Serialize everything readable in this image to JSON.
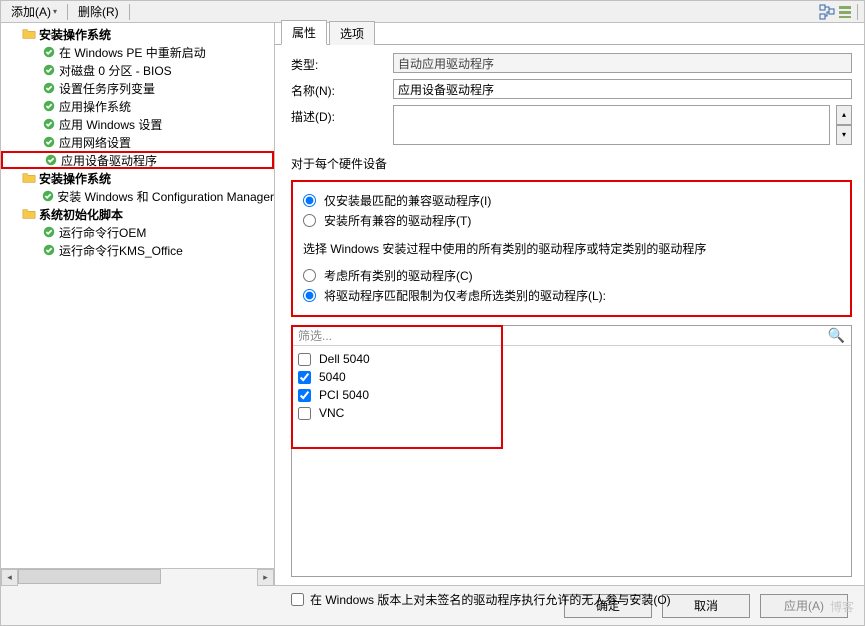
{
  "toolbar": {
    "add_label": "添加(A)",
    "delete_label": "删除(R)"
  },
  "tree": {
    "nodes": [
      {
        "level": 0,
        "icon": "folder",
        "label": "安装操作系统",
        "bold": true
      },
      {
        "level": 1,
        "icon": "check",
        "label": "在 Windows PE 中重新启动"
      },
      {
        "level": 1,
        "icon": "check",
        "label": "对磁盘 0 分区 - BIOS"
      },
      {
        "level": 1,
        "icon": "check",
        "label": "设置任务序列变量"
      },
      {
        "level": 1,
        "icon": "check",
        "label": "应用操作系统"
      },
      {
        "level": 1,
        "icon": "check",
        "label": "应用 Windows 设置"
      },
      {
        "level": 1,
        "icon": "check",
        "label": "应用网络设置"
      },
      {
        "level": 1,
        "icon": "check",
        "label": "应用设备驱动程序",
        "highlight": true
      },
      {
        "level": 0,
        "icon": "folder",
        "label": "安装操作系统",
        "bold": true
      },
      {
        "level": 1,
        "icon": "check",
        "label": "安装 Windows 和 Configuration Manager"
      },
      {
        "level": 0,
        "icon": "folder",
        "label": "系统初始化脚本",
        "bold": true
      },
      {
        "level": 1,
        "icon": "check",
        "label": "运行命令行OEM"
      },
      {
        "level": 1,
        "icon": "check",
        "label": "运行命令行KMS_Office"
      }
    ]
  },
  "tabs": {
    "properties": "属性",
    "options": "选项"
  },
  "form": {
    "type_label": "类型:",
    "type_value": "自动应用驱动程序",
    "name_label": "名称(N):",
    "name_value": "应用设备驱动程序",
    "desc_label": "描述(D):",
    "desc_value": ""
  },
  "hw_section": {
    "title": "对于每个硬件设备",
    "radio_best": "仅安装最匹配的兼容驱动程序(I)",
    "radio_all": "安装所有兼容的驱动程序(T)",
    "explain": "选择 Windows 安装过程中使用的所有类别的驱动程序或特定类别的驱动程序",
    "radio_allcat": "考虑所有类别的驱动程序(C)",
    "radio_limit": "将驱动程序匹配限制为仅考虑所选类别的驱动程序(L):"
  },
  "filter": {
    "placeholder": "筛选...",
    "items": [
      {
        "label": "Dell 5040",
        "checked": false
      },
      {
        "label": "5040",
        "checked": true
      },
      {
        "label": "PCI 5040",
        "checked": true
      },
      {
        "label": "VNC",
        "checked": false
      }
    ]
  },
  "unsigned": {
    "label": "在 Windows 版本上对未签名的驱动程序执行允许的无人参与安装(O)"
  },
  "footer": {
    "ok": "确定",
    "cancel": "取消",
    "apply": "应用(A)"
  },
  "watermark": "博客"
}
